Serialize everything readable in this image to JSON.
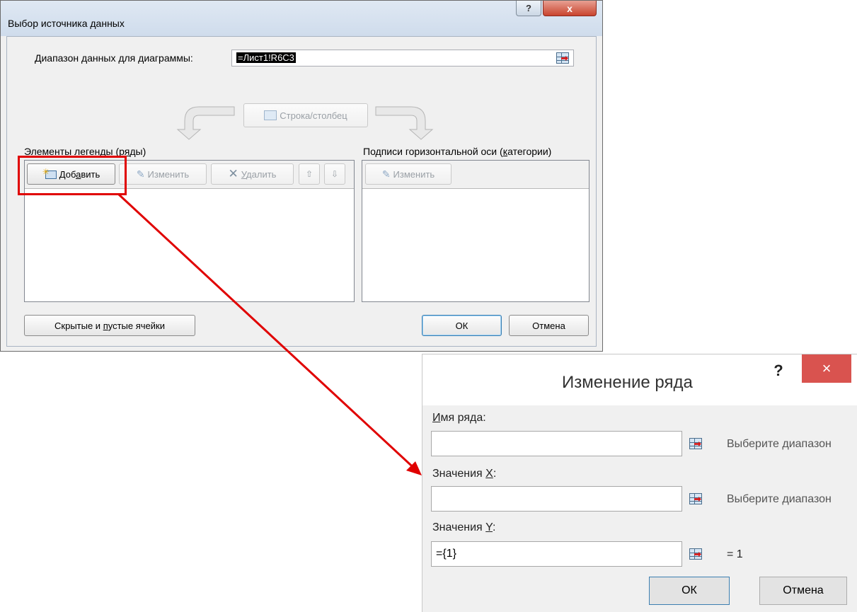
{
  "dialog1": {
    "title": "Выбор источника данных",
    "help": "?",
    "close": "x",
    "range_label": "Диапазон данных для диаграммы:",
    "range_value": "=Лист1!R6C3",
    "switch_label": "Строка/столбец",
    "legend_label": "Элементы легенды (ряды)",
    "axis_label": "Подписи горизонтальной оси (категории)",
    "add_label": "Добавить",
    "edit_label": "Изменить",
    "delete_label": "Удалить",
    "axis_edit_label": "Изменить",
    "hidden_cells_label": "Скрытые и пустые ячейки",
    "ok_label": "ОК",
    "cancel_label": "Отмена"
  },
  "dialog2": {
    "title": "Изменение ряда",
    "help": "?",
    "close": "×",
    "name_label": "Имя ряда:",
    "name_value": "",
    "name_hint": "Выберите диапазон",
    "x_label": "Значения X:",
    "x_value": "",
    "x_hint": "Выберите диапазон",
    "y_label": "Значения Y:",
    "y_value": "={1}",
    "y_result": "= 1",
    "ok_label": "ОК",
    "cancel_label": "Отмена"
  },
  "colors": {
    "highlight": "#e00000",
    "close_red": "#d9534f"
  }
}
